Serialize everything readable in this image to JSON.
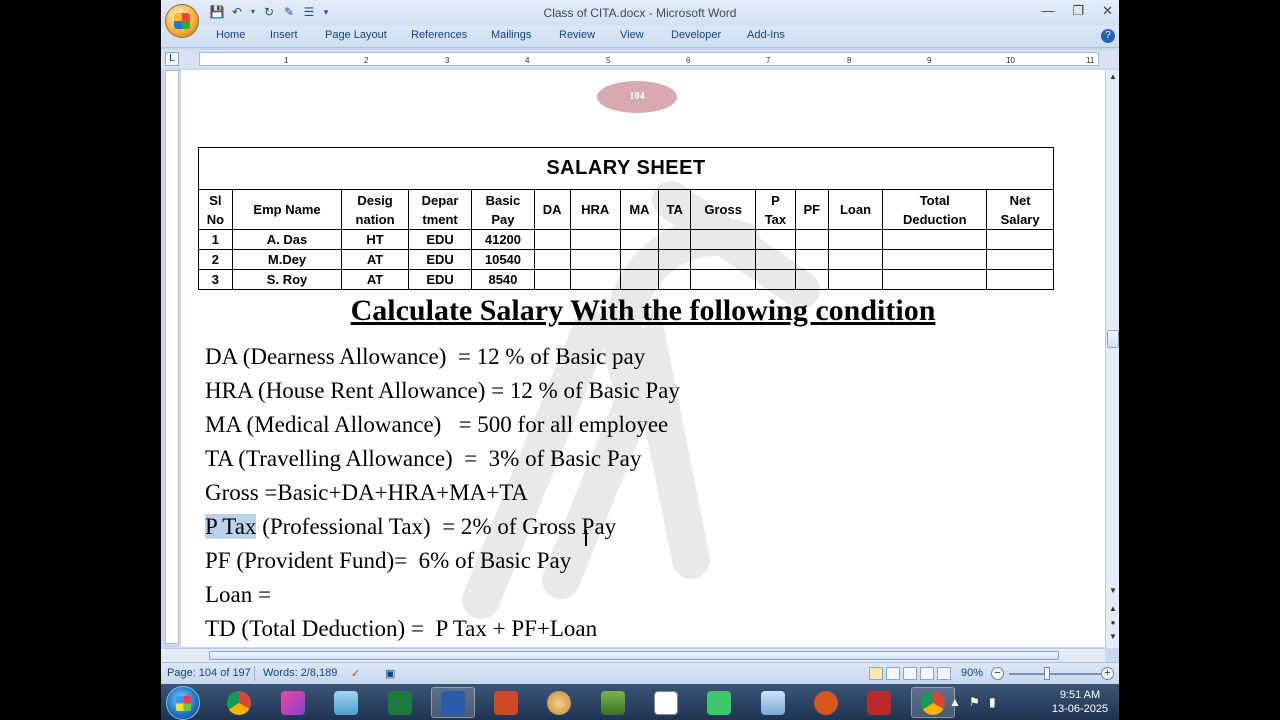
{
  "window": {
    "title": "Class of CITA.docx - Microsoft Word"
  },
  "ribbon": {
    "tabs": [
      "Home",
      "Insert",
      "Page Layout",
      "References",
      "Mailings",
      "Review",
      "View",
      "Developer",
      "Add-Ins"
    ]
  },
  "ruler": {
    "ticks": [
      "1",
      "2",
      "3",
      "4",
      "5",
      "6",
      "7",
      "8",
      "9",
      "10",
      "11"
    ]
  },
  "page_number_badge": "104",
  "salary_sheet": {
    "title": "SALARY SHEET",
    "headers": [
      [
        "Sl",
        "No"
      ],
      [
        "Emp Name"
      ],
      [
        "Desig",
        "nation"
      ],
      [
        "Depar",
        "tment"
      ],
      [
        "Basic",
        "Pay"
      ],
      [
        "DA"
      ],
      [
        "HRA"
      ],
      [
        "MA"
      ],
      [
        "TA"
      ],
      [
        "Gross"
      ],
      [
        "P",
        "Tax"
      ],
      [
        "PF"
      ],
      [
        "Loan"
      ],
      [
        "Total",
        "Deduction"
      ],
      [
        "Net",
        "Salary"
      ]
    ],
    "rows": [
      [
        "1",
        "A. Das",
        "HT",
        "EDU",
        "41200",
        "",
        "",
        "",
        "",
        "",
        "",
        "",
        "",
        "",
        ""
      ],
      [
        "2",
        "M.Dey",
        "AT",
        "EDU",
        "10540",
        "",
        "",
        "",
        "",
        "",
        "",
        "",
        "",
        "",
        ""
      ],
      [
        "3",
        "S. Roy",
        "AT",
        "EDU",
        "8540",
        "",
        "",
        "",
        "",
        "",
        "",
        "",
        "",
        "",
        ""
      ]
    ]
  },
  "heading": "Calculate Salary With the following condition",
  "conditions": [
    {
      "highlight": "",
      "text": "DA (Dearness Allowance)  = 12 % of Basic pay"
    },
    {
      "highlight": "",
      "text": "HRA (House Rent Allowance) = 12 % of Basic Pay"
    },
    {
      "highlight": "",
      "text": "MA (Medical Allowance)   = 500 for all employee"
    },
    {
      "highlight": "",
      "text": "TA (Travelling Allowance)  =  3% of Basic Pay"
    },
    {
      "highlight": "",
      "text": "Gross =Basic+DA+HRA+MA+TA"
    },
    {
      "highlight": "P Tax",
      "text": " (Professional Tax)  = 2% of Gross Pay"
    },
    {
      "highlight": "",
      "text": "PF (Provident Fund)=  6% of Basic Pay"
    },
    {
      "highlight": "",
      "text": "Loan ="
    },
    {
      "highlight": "",
      "text": "TD (Total Deduction) =  P Tax + PF+Loan"
    }
  ],
  "status_bar": {
    "page": "Page: 104 of 197",
    "words": "Words: 2/8,189",
    "zoom": "90%",
    "zoom_level_percent": 90
  },
  "taskbar": {
    "apps": [
      "chrome",
      "paint-shop",
      "notepad",
      "excel",
      "word",
      "presentation",
      "paint",
      "calculator",
      "graph",
      "shell",
      "explorer",
      "gimp-fox",
      "acrobat",
      "chrome-active"
    ],
    "clock_time": "9:51 AM",
    "clock_date": "13-06-2025"
  },
  "colors": {
    "ribbon": "#cfdef1",
    "highlight": "#bcd2ea",
    "page_badge": "#d8a9b0"
  }
}
